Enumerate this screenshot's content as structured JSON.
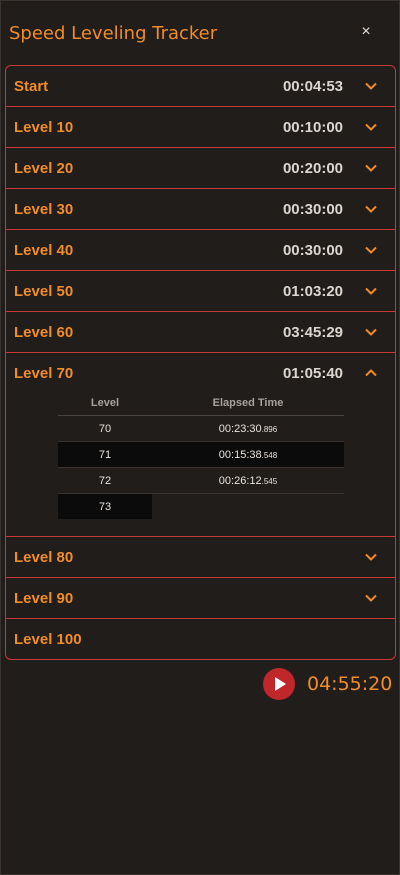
{
  "window": {
    "title": "Speed Leveling Tracker",
    "close_glyph": "×"
  },
  "rows": [
    {
      "label": "Start",
      "time": "00:04:53"
    },
    {
      "label": "Level 10",
      "time": "00:10:00"
    },
    {
      "label": "Level 20",
      "time": "00:20:00"
    },
    {
      "label": "Level 30",
      "time": "00:30:00"
    },
    {
      "label": "Level 40",
      "time": "00:30:00"
    },
    {
      "label": "Level 50",
      "time": "01:03:20"
    },
    {
      "label": "Level 60",
      "time": "03:45:29"
    },
    {
      "label": "Level 70",
      "time": "01:05:40"
    },
    {
      "label": "Level 80",
      "time": ""
    },
    {
      "label": "Level 90",
      "time": ""
    },
    {
      "label": "Level 100",
      "time": ""
    }
  ],
  "detail": {
    "col_level": "Level",
    "col_elapsed": "Elapsed Time",
    "entries": [
      {
        "level": "70",
        "time": "00:23:30",
        "ms": ".896"
      },
      {
        "level": "71",
        "time": "00:15:38",
        "ms": ".548"
      },
      {
        "level": "72",
        "time": "00:26:12",
        "ms": ".545"
      },
      {
        "level": "73",
        "time": "",
        "ms": ""
      }
    ]
  },
  "footer": {
    "total_time": "04:55:20"
  },
  "colors": {
    "accent": "#f08c2a",
    "border": "#c5393a",
    "play": "#c0272b"
  },
  "icons": {
    "close": "close-icon",
    "expand": "chevron-down-icon",
    "collapse": "chevron-up-icon",
    "play": "play-icon"
  }
}
